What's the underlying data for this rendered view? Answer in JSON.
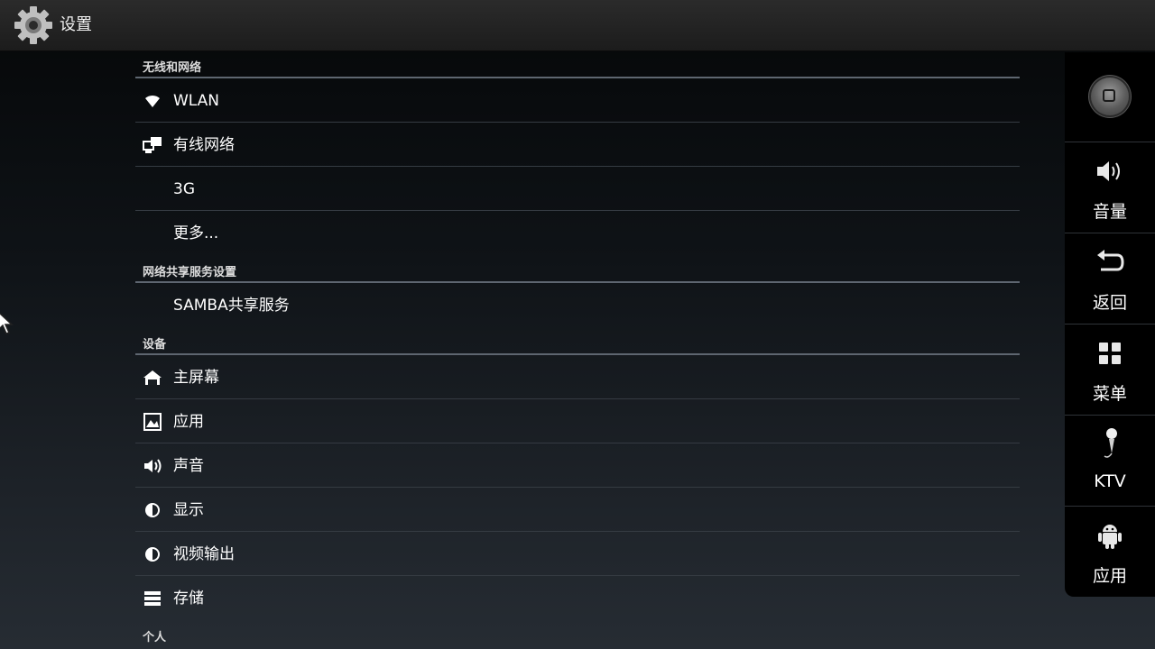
{
  "action_bar": {
    "title": "设置",
    "icon": "gear-icon"
  },
  "sections": [
    {
      "title": "无线和网络",
      "items": [
        {
          "label": "WLAN",
          "icon": "wifi-icon"
        },
        {
          "label": "有线网络",
          "icon": "ethernet-icon"
        },
        {
          "label": "3G",
          "icon": ""
        },
        {
          "label": "更多...",
          "icon": ""
        }
      ]
    },
    {
      "title": "网络共享服务设置",
      "items": [
        {
          "label": "SAMBA共享服务",
          "icon": ""
        }
      ]
    },
    {
      "title": "设备",
      "items": [
        {
          "label": "主屏幕",
          "icon": "home-icon"
        },
        {
          "label": "应用",
          "icon": "apps-icon"
        },
        {
          "label": "声音",
          "icon": "sound-icon"
        },
        {
          "label": "显示",
          "icon": "brightness-icon"
        },
        {
          "label": "视频输出",
          "icon": "brightness-icon"
        },
        {
          "label": "存储",
          "icon": "storage-icon"
        }
      ]
    },
    {
      "title": "个人",
      "items": []
    }
  ],
  "side_panel": {
    "home_icon": "home-button-icon",
    "buttons": [
      {
        "label": "音量",
        "icon": "volume-icon"
      },
      {
        "label": "返回",
        "icon": "back-icon"
      },
      {
        "label": "菜单",
        "icon": "menu-grid-icon"
      },
      {
        "label": "KTV",
        "icon": "microphone-icon"
      },
      {
        "label": "应用",
        "icon": "android-icon"
      }
    ]
  }
}
